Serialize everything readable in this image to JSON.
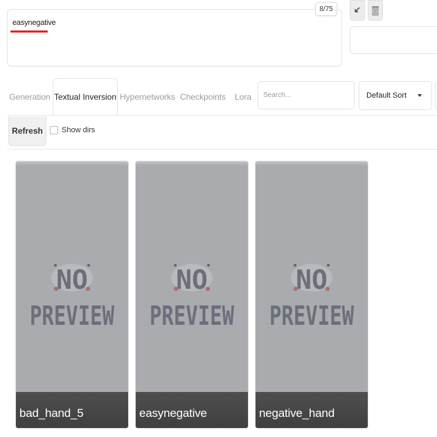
{
  "prompt": {
    "text": "easynegative",
    "token_count": "8/75"
  },
  "tabs": [
    {
      "label": "Generation",
      "active": false
    },
    {
      "label": "Textual Inversion",
      "active": true
    },
    {
      "label": "Hypernetworks",
      "active": false
    },
    {
      "label": "Checkpoints",
      "active": false
    },
    {
      "label": "Lora",
      "active": false
    }
  ],
  "search": {
    "placeholder": "Search...",
    "value": ""
  },
  "sort": {
    "selected": "Default Sort"
  },
  "toolbar": {
    "refresh_label": "Refresh",
    "show_dirs_label": "Show dirs",
    "show_dirs_checked": false
  },
  "cards": [
    {
      "name": "bad_hand_5",
      "preview_line1": "NO",
      "preview_line2": "PREVIEW"
    },
    {
      "name": "easynegative",
      "preview_line1": "NO",
      "preview_line2": "PREVIEW"
    },
    {
      "name": "negative_hand",
      "preview_line1": "NO",
      "preview_line2": "PREVIEW"
    }
  ],
  "icons": {
    "arrow": "arrow-down-left-icon",
    "trash": "trash-icon"
  },
  "colors": {
    "accent_underline": "#e02424",
    "card_bg": "#a9abae",
    "caption_bar": "#444444",
    "preview_text": "#6b6f7b"
  }
}
